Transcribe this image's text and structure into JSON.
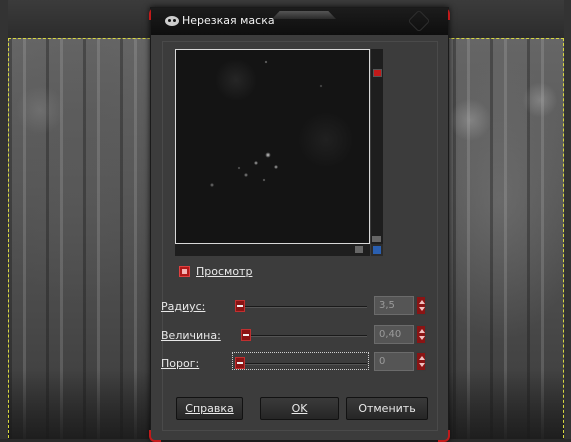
{
  "dialog": {
    "title": "Нерезкая маска",
    "preview_label": "Просмотр",
    "preview_checked": true,
    "params": [
      {
        "label": "Радиус:",
        "value": "3,5",
        "level": 0.03
      },
      {
        "label": "Величина:",
        "value": "0,40",
        "level": 0.04
      },
      {
        "label": "Порог:",
        "value": "0",
        "level": 0.0
      }
    ],
    "buttons": {
      "help": "Справка",
      "ok": "OK",
      "cancel": "Отменить"
    }
  },
  "icons": {
    "title": "gimp-wilber-icon",
    "close": "close-icon",
    "navigate": "navigate-icon"
  },
  "colors": {
    "accent": "#c21a1a",
    "dialog_bg": "#3c3c3c",
    "titlebar": "#0e0e0e",
    "selection_marching_ants": "#d8d840"
  }
}
